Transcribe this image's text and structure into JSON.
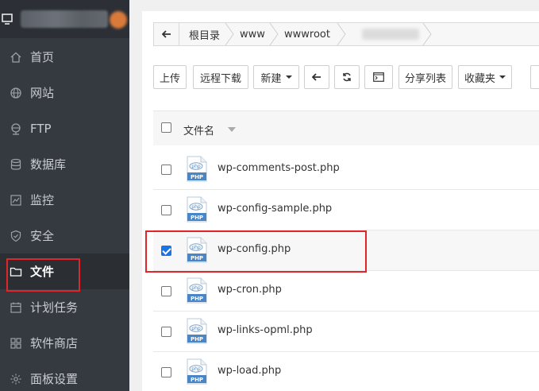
{
  "sidebar": {
    "items": [
      {
        "label": "首页",
        "icon": "home-icon"
      },
      {
        "label": "网站",
        "icon": "globe-icon"
      },
      {
        "label": "FTP",
        "icon": "ftp-globe-icon"
      },
      {
        "label": "数据库",
        "icon": "database-icon"
      },
      {
        "label": "监控",
        "icon": "monitor-icon"
      },
      {
        "label": "安全",
        "icon": "shield-icon"
      },
      {
        "label": "文件",
        "icon": "folder-icon",
        "active": true
      },
      {
        "label": "计划任务",
        "icon": "calendar-icon"
      },
      {
        "label": "软件商店",
        "icon": "apps-icon"
      },
      {
        "label": "面板设置",
        "icon": "gear-icon"
      }
    ]
  },
  "path": {
    "crumbs": [
      "根目录",
      "www",
      "wwwroot"
    ]
  },
  "toolbar": {
    "upload": "上传",
    "remote_download": "远程下载",
    "new": "新建",
    "share_list": "分享列表",
    "favorites": "收藏夹"
  },
  "table": {
    "header": "文件名",
    "rows": [
      {
        "name": "wp-comments-post.php",
        "selected": false
      },
      {
        "name": "wp-config-sample.php",
        "selected": false
      },
      {
        "name": "wp-config.php",
        "selected": true
      },
      {
        "name": "wp-cron.php",
        "selected": false
      },
      {
        "name": "wp-links-opml.php",
        "selected": false
      },
      {
        "name": "wp-load.php",
        "selected": false
      }
    ],
    "file_icon_text": "PHP",
    "file_icon_top_text": "php"
  },
  "colors": {
    "sidebar_bg": "#353a40",
    "highlight": "#e0262b",
    "php_blue": "#4a86c5",
    "check_blue": "#1a73e8"
  }
}
